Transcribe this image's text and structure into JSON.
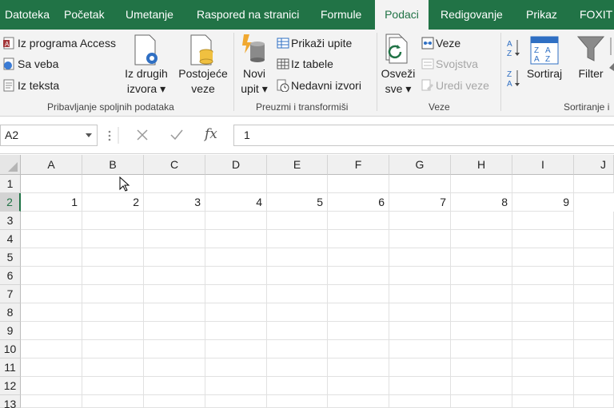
{
  "tabs": [
    "Datoteka",
    "Početak",
    "Umetanje",
    "Raspored na stranici",
    "Formule",
    "Podaci",
    "Redigovanje",
    "Prikaz",
    "FOXIT I"
  ],
  "active_tab": "Podaci",
  "ribbon": {
    "external": {
      "access": "Iz programa Access",
      "web": "Sa veba",
      "text": "Iz teksta",
      "other_1": "Iz drugih",
      "other_2": "izvora",
      "existing_1": "Postojeće",
      "existing_2": "veze",
      "label": "Pribavljanje spoljnih podataka"
    },
    "transform": {
      "new_query_1": "Novi",
      "new_query_2": "upit",
      "show_queries": "Prikaži upite",
      "from_table": "Iz tabele",
      "recent_sources": "Nedavni izvori",
      "label": "Preuzmi i transformiši"
    },
    "connections": {
      "refresh_1": "Osveži",
      "refresh_2": "sve",
      "connections": "Veze",
      "properties": "Svojstva",
      "edit_links": "Uredi veze",
      "label": "Veze"
    },
    "sort": {
      "sort": "Sortiraj",
      "filter": "Filter",
      "label": "Sortiranje i"
    }
  },
  "formula_bar": {
    "name_box": "A2",
    "fx": "fx",
    "value": "1"
  },
  "sheet": {
    "columns": [
      "A",
      "B",
      "C",
      "D",
      "E",
      "F",
      "G",
      "H",
      "I",
      "J"
    ],
    "rows": [
      "1",
      "2",
      "3",
      "4",
      "5",
      "6",
      "7",
      "8",
      "9",
      "10",
      "11",
      "12",
      "13"
    ],
    "row2_values": [
      "1",
      "2",
      "3",
      "4",
      "5",
      "6",
      "7",
      "8",
      "9",
      ""
    ]
  },
  "colors": {
    "brand": "#217346",
    "ribbon_bg": "#f3f3f3"
  }
}
